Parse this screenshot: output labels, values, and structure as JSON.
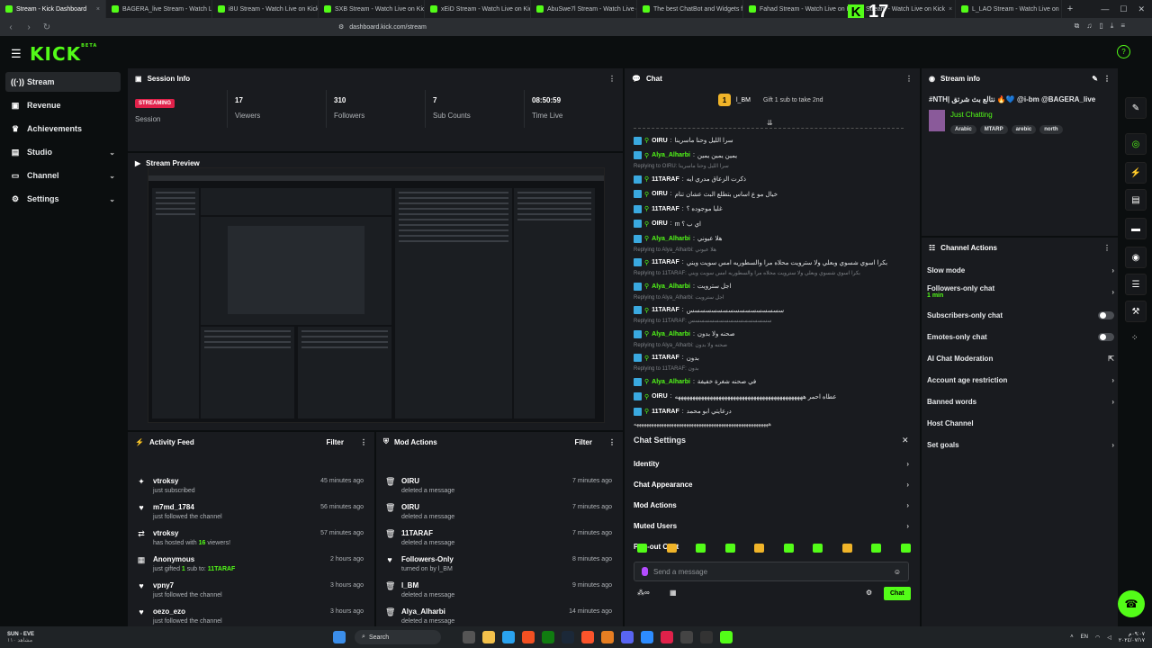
{
  "browser": {
    "tabs": [
      {
        "title": "Stream - Kick Dashboard",
        "active": true
      },
      {
        "title": "BAGERA_live Stream - Watch Live o"
      },
      {
        "title": "i8U Stream - Watch Live on Kick"
      },
      {
        "title": "SXB Stream - Watch Live on Kick"
      },
      {
        "title": "xEiD Stream - Watch Live on Kick"
      },
      {
        "title": "AbuSwe7l Stream - Watch Live on"
      },
      {
        "title": "The best ChatBot and Widgets for"
      },
      {
        "title": "Fahad Stream - Watch Live on Kick"
      },
      {
        "title": "Stream - Watch Live on Kick"
      },
      {
        "title": "L_LAO Stream - Watch Live on Kick"
      }
    ],
    "url": "dashboard.kick.com/stream",
    "overlay_number": "17"
  },
  "brand": {
    "logo": "KICK",
    "beta": "BETA",
    "accent": "#53fc18"
  },
  "sidebar": {
    "items": [
      {
        "label": "Stream",
        "icon": "radio-icon",
        "active": true
      },
      {
        "label": "Revenue",
        "icon": "wallet-icon"
      },
      {
        "label": "Achievements",
        "icon": "trophy-icon"
      },
      {
        "label": "Studio",
        "icon": "studio-icon",
        "expandable": true
      },
      {
        "label": "Channel",
        "icon": "tv-icon",
        "expandable": true
      },
      {
        "label": "Settings",
        "icon": "gear-icon",
        "expandable": true
      }
    ]
  },
  "session": {
    "title": "Session Info",
    "status": "STREAMING",
    "stats": [
      {
        "value": "",
        "label": "Session"
      },
      {
        "value": "17",
        "label": "Viewers"
      },
      {
        "value": "310",
        "label": "Followers"
      },
      {
        "value": "7",
        "label": "Sub Counts"
      },
      {
        "value": "08:50:59",
        "label": "Time Live"
      }
    ]
  },
  "preview": {
    "title": "Stream Preview"
  },
  "activity": {
    "title": "Activity Feed",
    "filter": "Filter",
    "items": [
      {
        "icon": "sparkle-icon",
        "name": "vtroksy",
        "text": "just subscribed",
        "time": "45 minutes ago"
      },
      {
        "icon": "heart-icon",
        "name": "m7md_1784",
        "text": "just followed the channel",
        "time": "56 minutes ago"
      },
      {
        "icon": "host-icon",
        "name": "vtroksy",
        "text_pre": "has hosted with ",
        "hl": "16",
        "text_post": " viewers!",
        "time": "57 minutes ago"
      },
      {
        "icon": "gift-icon",
        "name": "Anonymous",
        "text_pre": "just gifted ",
        "hl": "1",
        "text_post": " sub to: ",
        "hl2": "11TARAF",
        "time": "2 hours ago"
      },
      {
        "icon": "heart-icon",
        "name": "vpny7",
        "text": "just followed the channel",
        "time": "3 hours ago"
      },
      {
        "icon": "heart-icon",
        "name": "oezo_ezo",
        "text": "just followed the channel",
        "time": "3 hours ago"
      }
    ]
  },
  "mod_actions": {
    "title": "Mod Actions",
    "filter": "Filter",
    "items": [
      {
        "icon": "trash-icon",
        "name": "OIRU",
        "text": "deleted a message",
        "time": "7 minutes ago"
      },
      {
        "icon": "trash-icon",
        "name": "OIRU",
        "text": "deleted a message",
        "time": "7 minutes ago"
      },
      {
        "icon": "trash-icon",
        "name": "11TARAF",
        "text": "deleted a message",
        "time": "7 minutes ago"
      },
      {
        "icon": "heart-icon",
        "name": "Followers-Only",
        "text": "turned on by l_BM",
        "time": "8 minutes ago"
      },
      {
        "icon": "trash-icon",
        "name": "l_BM",
        "text": "deleted a message",
        "time": "9 minutes ago"
      },
      {
        "icon": "trash-icon",
        "name": "Alya_Alharbi",
        "text": "deleted a message",
        "time": "14 minutes ago"
      }
    ]
  },
  "chat": {
    "title": "Chat",
    "pinned_user": "l_BM",
    "pinned_count": "1",
    "gift_text": "Gift 1 sub to take 2nd",
    "messages": [
      {
        "type": "msg",
        "user": "OIRU",
        "text": "سرا الليل وحنا ماسرينا"
      },
      {
        "type": "msg",
        "user": "Alya_Alharbi",
        "alt": true,
        "text": "يمين يمين يمين"
      },
      {
        "type": "reply",
        "text": "Replying to OIRU: سرا الليل وحنا ماسرينا"
      },
      {
        "type": "msg",
        "user": "11TARAF",
        "text": "ذكرت الزعاق مدري ايه"
      },
      {
        "type": "msg",
        "user": "OIRU",
        "text": "خيال مو ع اساس بتطلع البث عشان تنام"
      },
      {
        "type": "msg",
        "user": "11TARAF",
        "text": "غليا موجوده ؟"
      },
      {
        "type": "msg",
        "user": "OIRU",
        "text": "m اي ب ؟"
      },
      {
        "type": "msg",
        "user": "Alya_Alharbi",
        "alt": true,
        "text": "هلا عيوني"
      },
      {
        "type": "reply",
        "text": "Replying to Alya_Alharbi: هلا عيوني"
      },
      {
        "type": "msg",
        "user": "11TARAF",
        "text": "بكرا اسوي شسوي وبعلي ولا سترويت محلاه مرا والسطوريه امس سويت ويني"
      },
      {
        "type": "reply",
        "text": "Replying to 11TARAF: بكرا اسوي شسوي وبعلي ولا سترويت محلاه مرا والسطوريه امس سويت ويني"
      },
      {
        "type": "msg",
        "user": "Alya_Alharbi",
        "alt": true,
        "text": "اجل سترويت"
      },
      {
        "type": "reply",
        "text": "Replying to Alya_Alharbi: اجل سترويت"
      },
      {
        "type": "msg",
        "user": "11TARAF",
        "text": "سسسسسسسسسسسسسسسسس"
      },
      {
        "type": "reply",
        "text": "Replying to 11TARAF: سسسسسسسسسسسسسسسسس"
      },
      {
        "type": "msg",
        "user": "Alya_Alharbi",
        "alt": true,
        "text": "صحنه ولا بدون"
      },
      {
        "type": "reply",
        "text": "Replying to Alya_Alharbi: صحنه ولا بدون"
      },
      {
        "type": "msg",
        "user": "11TARAF",
        "text": "بدون"
      },
      {
        "type": "reply",
        "text": "Replying to 11TARAF: بدون"
      },
      {
        "type": "msg",
        "user": "Alya_Alharbi",
        "alt": true,
        "text": "في صحنه شغرة خفيفة"
      },
      {
        "type": "msg",
        "user": "OIRU",
        "text": "عطاه احمر ههههههههههههههههههههههههههههههههههههههههههههه"
      },
      {
        "type": "msg",
        "user": "11TARAF",
        "text": "درعايتي ابو محمد"
      }
    ],
    "trailer": "ههههههههههههههههههههههههههههههههههههههههههههههههههههههه",
    "settings": {
      "title": "Chat Settings",
      "rows": [
        "Identity",
        "Chat Appearance",
        "Mod Actions",
        "Muted Users",
        "Pop-out Chat"
      ]
    },
    "input_placeholder": "Send a message",
    "send_label": "Chat"
  },
  "stream_info": {
    "title": "Stream info",
    "stream_title": "#NTH| نتالع بث شرتق 🔥💙 @i-bm @BAGERA_live",
    "category": "Just Chatting",
    "tags": [
      "Arabic",
      "MTARP",
      "arebic",
      "north"
    ]
  },
  "channel_actions": {
    "title": "Channel Actions",
    "rows": [
      {
        "label": "Slow mode",
        "control": "arrow"
      },
      {
        "label": "Followers-only chat",
        "sub": "1 min",
        "control": "arrow"
      },
      {
        "label": "Subscribers-only chat",
        "control": "toggle"
      },
      {
        "label": "Emotes-only chat",
        "control": "toggle"
      },
      {
        "label": "AI Chat Moderation",
        "control": "external"
      },
      {
        "label": "Account age restriction",
        "control": "arrow"
      },
      {
        "label": "Banned words",
        "control": "arrow"
      },
      {
        "label": "Host Channel",
        "control": "none"
      },
      {
        "label": "Set goals",
        "control": "arrow"
      }
    ]
  },
  "taskbar": {
    "weather": "SUN - EVE",
    "weather_sub": "مشاهد ١١٠",
    "search": "Search",
    "lang": "EN",
    "time": "٠٩:٠٧م",
    "date": "٢٠٢٤/٠٧/١٧"
  }
}
